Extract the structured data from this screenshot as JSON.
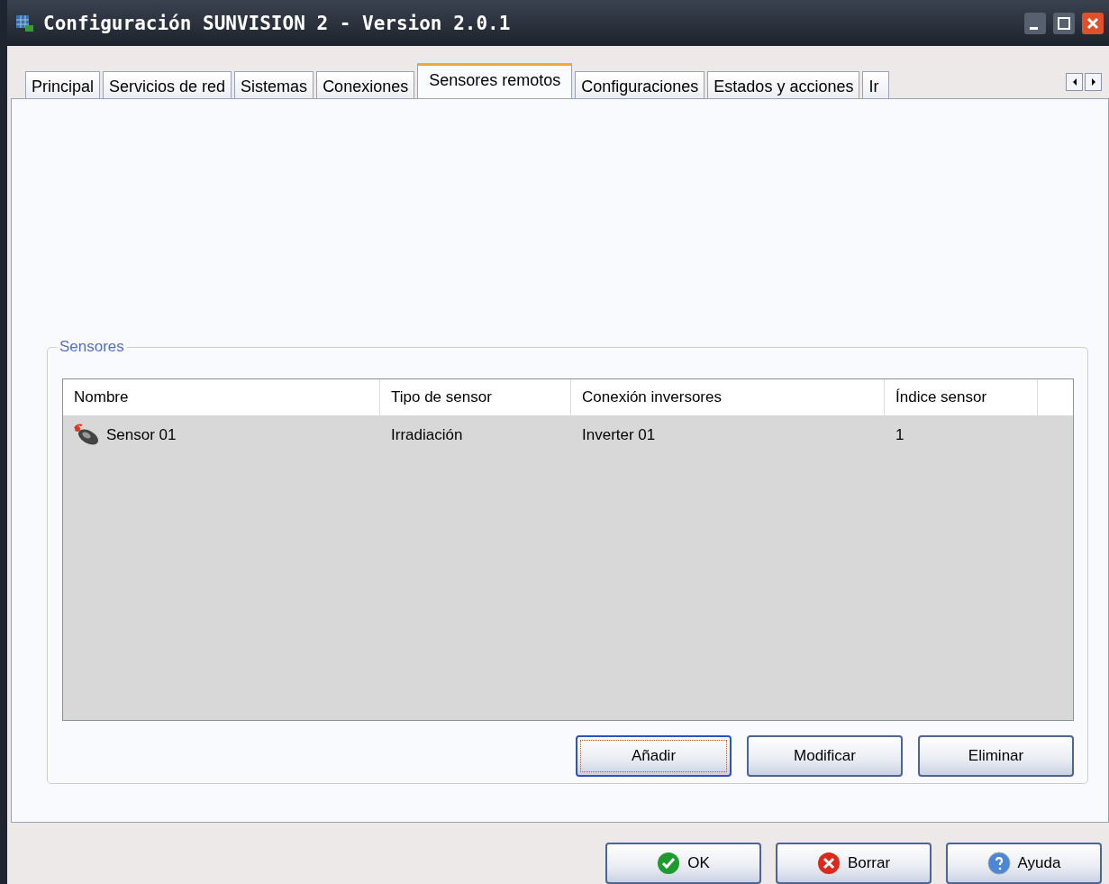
{
  "window": {
    "title": "Configuración SUNVISION 2 - Version 2.0.1"
  },
  "tabs": [
    {
      "label": "Principal",
      "selected": false
    },
    {
      "label": "Servicios de red",
      "selected": false
    },
    {
      "label": "Sistemas",
      "selected": false
    },
    {
      "label": "Conexiones",
      "selected": false
    },
    {
      "label": "Sensores remotos",
      "selected": true
    },
    {
      "label": "Configuraciones",
      "selected": false
    },
    {
      "label": "Estados y acciones",
      "selected": false
    },
    {
      "label": "Ir",
      "selected": false
    }
  ],
  "group": {
    "title": "Sensores"
  },
  "table": {
    "columns": [
      "Nombre",
      "Tipo de sensor",
      "Conexión inversores",
      "Índice sensor"
    ],
    "rows": [
      {
        "cells": [
          "Sensor 01",
          "Irradiación",
          "Inverter 01",
          "1"
        ]
      }
    ]
  },
  "group_buttons": [
    {
      "label": "Añadir",
      "focused": true
    },
    {
      "label": "Modificar",
      "focused": false
    },
    {
      "label": "Eliminar",
      "focused": false
    }
  ],
  "dialog_buttons": [
    {
      "label": "OK",
      "kind": "ok"
    },
    {
      "label": "Borrar",
      "kind": "clear"
    },
    {
      "label": "Ayuda",
      "kind": "help"
    }
  ]
}
